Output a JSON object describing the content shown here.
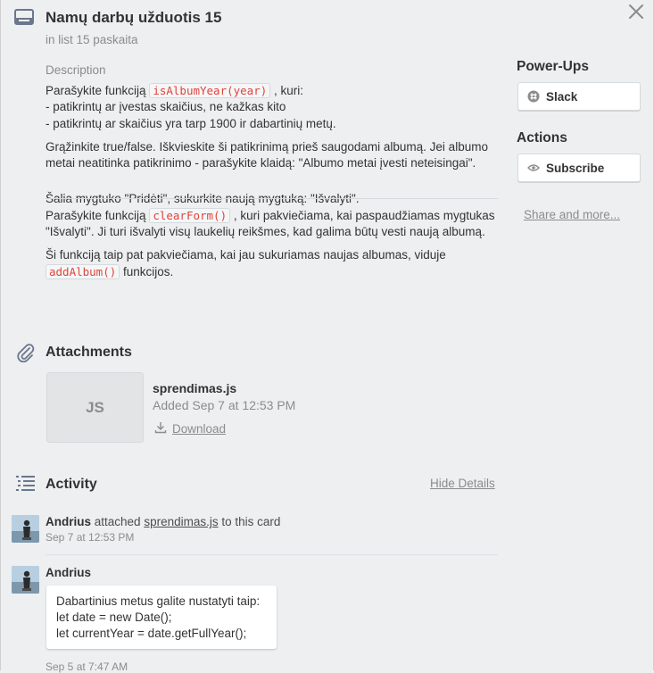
{
  "card": {
    "title": "Namų darbų užduotis 15",
    "list_info": "in list 15 paskaita"
  },
  "description": {
    "label": "Description",
    "p1_before": "Parašykite funkciją ",
    "p1_code": "isAlbumYear(year)",
    "p1_after": " , kuri:",
    "p1_line2": "- patikrintų ar įvestas skaičius, ne kažkas kito",
    "p1_line3": "- patikrintų ar skaičius yra tarp 1900 ir dabartinių metų.",
    "p2": "Grąžinkite true/false. Iškvieskite ši patikrinimą prieš saugodami albumą. Jei albumo metai neatitinka patikrinimo - parašykite klaidą: \"Albumo metai įvesti neteisingai\".",
    "p3_line1": "Šalia mygtuko \"Pridėti\", sukurkite naują mygtuką: \"Išvalyti\".",
    "p3_before": "Parašykite funkciją ",
    "p3_code": "clearForm()",
    "p3_after": " , kuri pakviečiama, kai paspaudžiamas mygtukas \"Išvalyti\". Ji turi išvalyti visų laukelių reikšmes, kad galima būtų vesti naują albumą.",
    "p4_before": "Ši funkciją taip pat pakviečiama, kai jau sukuriamas naujas albumas, viduje ",
    "p4_code": "addAlbum()",
    "p4_after": " funkcijos."
  },
  "sidebar": {
    "powerups_title": "Power-Ups",
    "slack_label": "Slack",
    "actions_title": "Actions",
    "subscribe_label": "Subscribe",
    "share_label": "Share and more..."
  },
  "attachments": {
    "title": "Attachments",
    "thumb_text": "JS",
    "file_name": "sprendimas.js",
    "added": "Added Sep 7 at 12:53 PM",
    "download_label": "Download"
  },
  "activity": {
    "title": "Activity",
    "hide_details_label": "Hide Details",
    "entries": [
      {
        "user": "Andrius",
        "action": " attached ",
        "link": "sprendimas.js",
        "suffix": " to this card",
        "date": "Sep 7 at 12:53 PM"
      }
    ],
    "comment": {
      "user": "Andrius",
      "lines": [
        "Dabartinius metus galite nustatyti taip:",
        "let date = new Date();",
        "let currentYear = date.getFullYear();"
      ],
      "date": "Sep 5 at 7:47 AM"
    }
  },
  "colors": {
    "background": "#edeff0",
    "code_text": "#e0443a",
    "muted_text": "#8c8c8c"
  }
}
